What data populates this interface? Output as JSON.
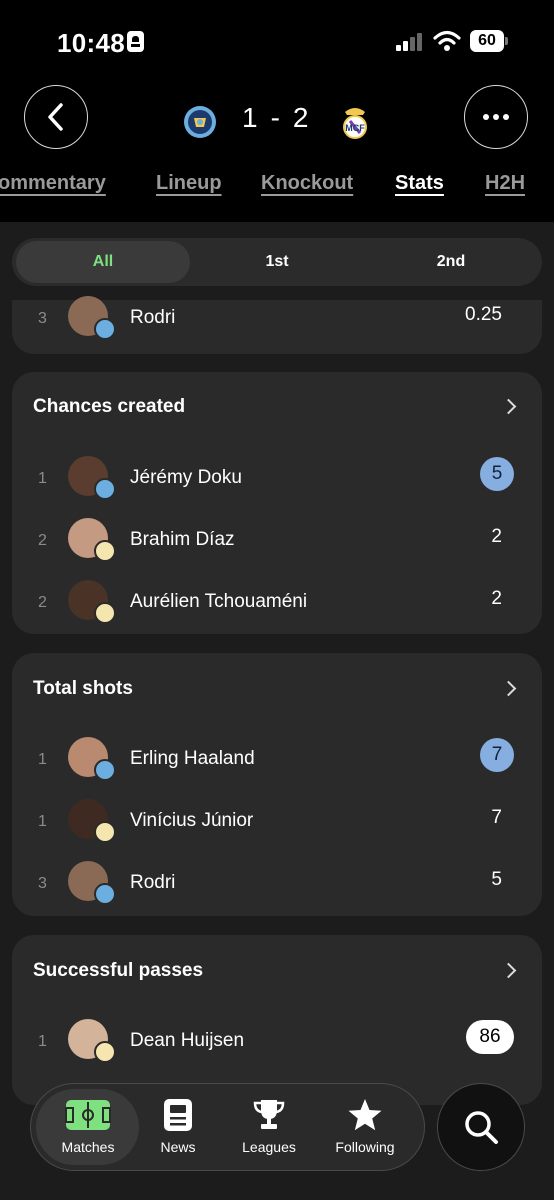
{
  "status_bar": {
    "time": "10:48",
    "battery": "60"
  },
  "match": {
    "home_score": "1",
    "separator": "-",
    "away_score": "2"
  },
  "tabs": [
    "ommentary",
    "Lineup",
    "Knockout",
    "Stats",
    "H2H"
  ],
  "active_tab": "Stats",
  "segments": [
    "All",
    "1st",
    "2nd"
  ],
  "active_segment": "All",
  "top_partial_row": {
    "rank": "3",
    "name": "Rodri",
    "value": "0.25"
  },
  "sections": [
    {
      "title": "Chances created",
      "rows": [
        {
          "rank": "1",
          "name": "Jérémy Doku",
          "value": "5",
          "highlight": "blue"
        },
        {
          "rank": "2",
          "name": "Brahim Díaz",
          "value": "2"
        },
        {
          "rank": "2",
          "name": "Aurélien Tchouaméni",
          "value": "2"
        }
      ]
    },
    {
      "title": "Total shots",
      "rows": [
        {
          "rank": "1",
          "name": "Erling Haaland",
          "value": "7",
          "highlight": "blue"
        },
        {
          "rank": "1",
          "name": "Vinícius Júnior",
          "value": "7"
        },
        {
          "rank": "3",
          "name": "Rodri",
          "value": "5"
        }
      ]
    },
    {
      "title": "Successful passes",
      "rows": [
        {
          "rank": "1",
          "name": "Dean Huijsen",
          "value": "86",
          "highlight": "white"
        }
      ]
    }
  ],
  "nav": {
    "matches": "Matches",
    "news": "News",
    "leagues": "Leagues",
    "following": "Following"
  },
  "colors": {
    "accent_green": "#7ee07e",
    "highlight_blue": "#86aee0",
    "card": "#2a2a2a"
  }
}
